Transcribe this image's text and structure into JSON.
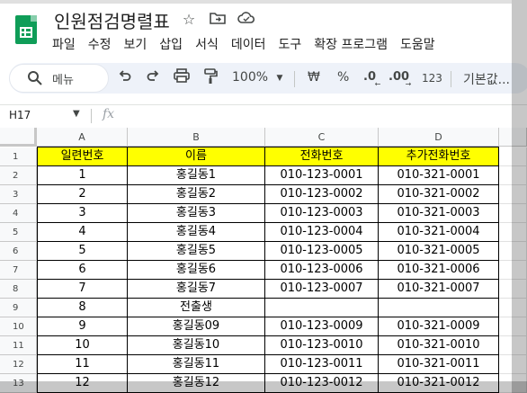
{
  "document": {
    "title": "인원점검명렬표"
  },
  "menu": [
    "파일",
    "수정",
    "보기",
    "삽입",
    "서식",
    "데이터",
    "도구",
    "확장 프로그램",
    "도움말"
  ],
  "toolbar": {
    "search_label": "메뉴",
    "zoom": "100%",
    "currency": "₩",
    "percent": "%",
    "decrease_decimal": ".0",
    "increase_decimal": ".00",
    "number_format": "123",
    "font": "기본값..."
  },
  "formula_bar": {
    "cell_ref": "H17",
    "fx": "fx"
  },
  "sheet": {
    "columns": [
      "A",
      "B",
      "C",
      "D"
    ],
    "row_numbers": [
      "1",
      "2",
      "3",
      "4",
      "5",
      "6",
      "7",
      "8",
      "9",
      "10",
      "11",
      "12",
      "13"
    ],
    "header": [
      "일련번호",
      "이름",
      "전화번호",
      "추가전화번호"
    ],
    "rows": [
      [
        "1",
        "홍길동1",
        "010-123-0001",
        "010-321-0001"
      ],
      [
        "2",
        "홍길동2",
        "010-123-0002",
        "010-321-0002"
      ],
      [
        "3",
        "홍길동3",
        "010-123-0003",
        "010-321-0003"
      ],
      [
        "4",
        "홍길동4",
        "010-123-0004",
        "010-321-0004"
      ],
      [
        "5",
        "홍길동5",
        "010-123-0005",
        "010-321-0005"
      ],
      [
        "6",
        "홍길동6",
        "010-123-0006",
        "010-321-0006"
      ],
      [
        "7",
        "홍길동7",
        "010-123-0007",
        "010-321-0007"
      ],
      [
        "8",
        "전출생",
        "",
        ""
      ],
      [
        "9",
        "홍길동09",
        "010-123-0009",
        "010-321-0009"
      ],
      [
        "10",
        "홍길동10",
        "010-123-0010",
        "010-321-0010"
      ],
      [
        "11",
        "홍길동11",
        "010-123-0011",
        "010-321-0011"
      ],
      [
        "12",
        "홍길동12",
        "010-123-0012",
        "010-321-0012"
      ]
    ]
  },
  "colors": {
    "header_fill": "#ffff00",
    "accent": "#0f9d58"
  }
}
